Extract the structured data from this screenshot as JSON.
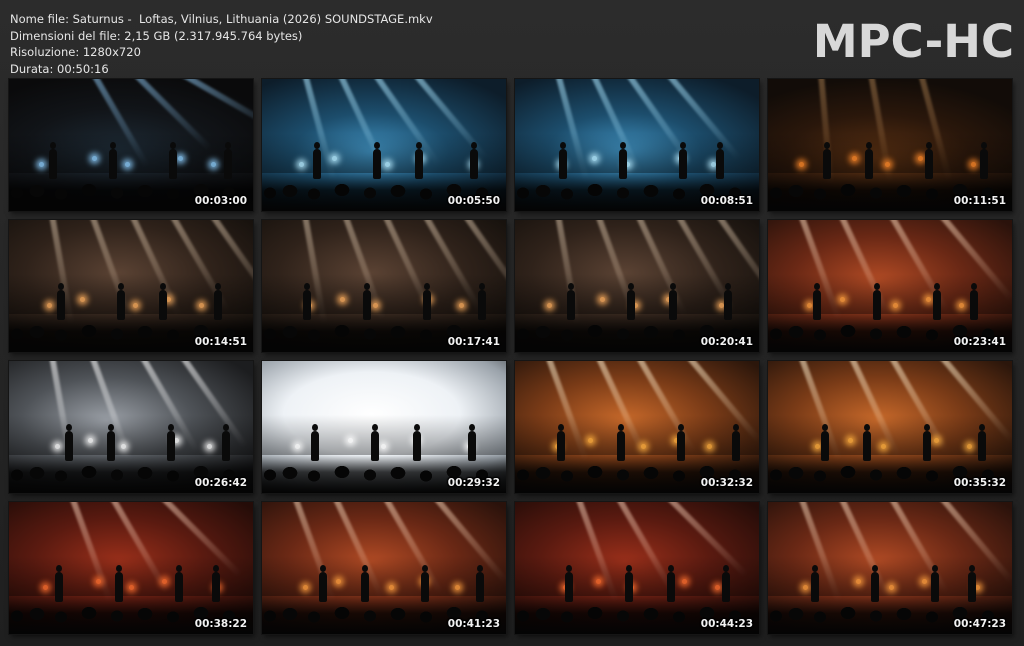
{
  "header": {
    "filename_line": "Nome file: Saturnus -  Loftas, Vilnius, Lithuania (2026) SOUNDSTAGE.mkv",
    "filesize_line": "Dimensioni del file: 2,15 GB (2.317.945.764 bytes)",
    "resolution_line": "Risoluzione: 1280x720",
    "duration_line": "Durata: 00:50:16"
  },
  "logo": "MPC-HC",
  "thumbnails": [
    {
      "timestamp": "00:03:00",
      "tone": "dark-blue"
    },
    {
      "timestamp": "00:05:50",
      "tone": "blue"
    },
    {
      "timestamp": "00:08:51",
      "tone": "blue"
    },
    {
      "timestamp": "00:11:51",
      "tone": "dark-orange"
    },
    {
      "timestamp": "00:14:51",
      "tone": "brown"
    },
    {
      "timestamp": "00:17:41",
      "tone": "brown"
    },
    {
      "timestamp": "00:20:41",
      "tone": "brown"
    },
    {
      "timestamp": "00:23:41",
      "tone": "red-orange"
    },
    {
      "timestamp": "00:26:42",
      "tone": "grey-white"
    },
    {
      "timestamp": "00:29:32",
      "tone": "white"
    },
    {
      "timestamp": "00:32:32",
      "tone": "orange"
    },
    {
      "timestamp": "00:35:32",
      "tone": "orange"
    },
    {
      "timestamp": "00:38:22",
      "tone": "red"
    },
    {
      "timestamp": "00:41:23",
      "tone": "red-orange"
    },
    {
      "timestamp": "00:44:23",
      "tone": "red"
    },
    {
      "timestamp": "00:47:23",
      "tone": "red-orange"
    }
  ]
}
